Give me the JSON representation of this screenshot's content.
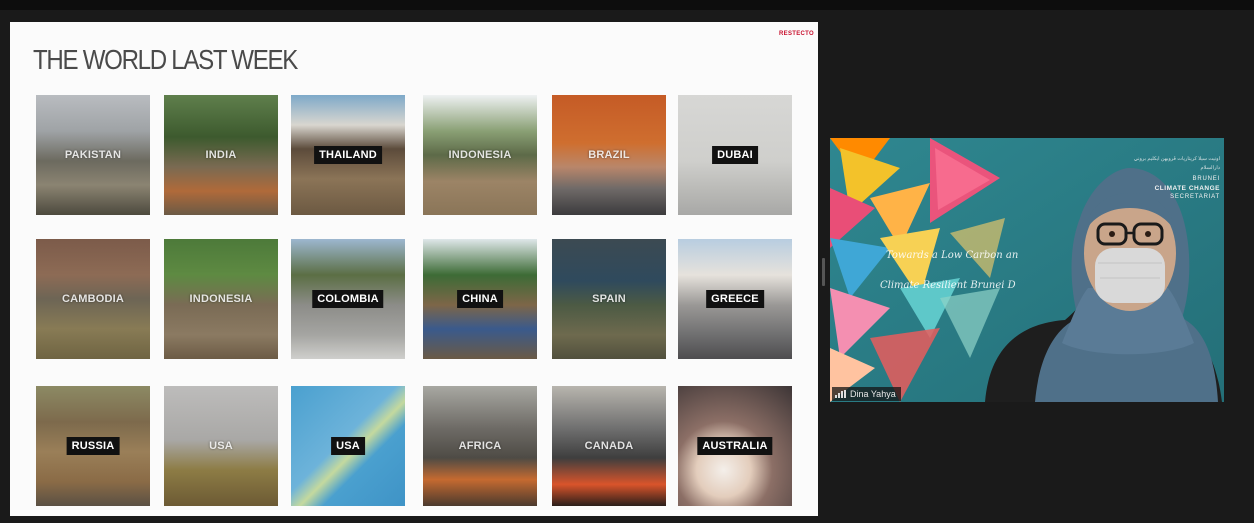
{
  "slide": {
    "title": "THE WORLD LAST WEEK",
    "brand": "RESTECTO",
    "tiles": [
      {
        "label": "PAKISTAN",
        "boxed": false
      },
      {
        "label": "INDIA",
        "boxed": false
      },
      {
        "label": "THAILAND",
        "boxed": true
      },
      {
        "label": "INDONESIA",
        "boxed": false
      },
      {
        "label": "BRAZIL",
        "boxed": false
      },
      {
        "label": "DUBAI",
        "boxed": true
      },
      {
        "label": "CAMBODIA",
        "boxed": false
      },
      {
        "label": "INDONESIA",
        "boxed": false
      },
      {
        "label": "COLOMBIA",
        "boxed": true
      },
      {
        "label": "CHINA",
        "boxed": true
      },
      {
        "label": "SPAIN",
        "boxed": false
      },
      {
        "label": "GREECE",
        "boxed": true
      },
      {
        "label": "RUSSIA",
        "boxed": true
      },
      {
        "label": "USA",
        "boxed": false
      },
      {
        "label": "USA",
        "boxed": true
      },
      {
        "label": "AFRICA",
        "boxed": false
      },
      {
        "label": "CANADA",
        "boxed": false
      },
      {
        "label": "AUSTRALIA",
        "boxed": true
      }
    ]
  },
  "participant": {
    "name": "Dina Yahya",
    "org_arabic": "اونيت سيلا كريتاريات ڤروبهن ايکليم بروني دارالسلام",
    "org_line1": "BRUNEI",
    "org_line2": "CLIMATE CHANGE",
    "org_line3": "SECRETARIAT",
    "script_line1": "Towards a Low Carbon an",
    "script_line2": "Climate Resilient Brunei D"
  }
}
